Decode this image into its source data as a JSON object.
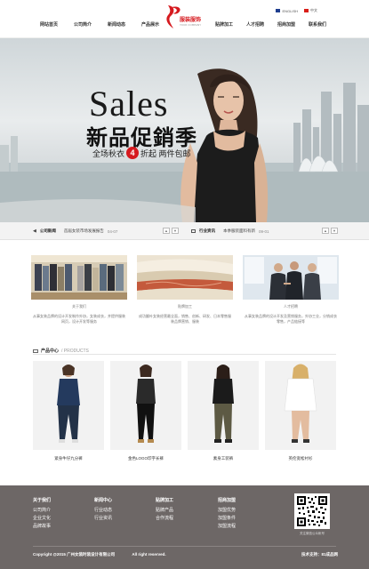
{
  "header": {
    "lang_en": "ENGLISH",
    "lang_cn": "中文",
    "logo_text": "服装服饰",
    "logo_sub": "YOUR COMPANY",
    "nav_left": [
      "网站首页",
      "公司简介",
      "新闻动态",
      "产品展示"
    ],
    "nav_right": [
      "贴牌加工",
      "人才招聘",
      "招商加盟",
      "联系我们"
    ]
  },
  "banner": {
    "title_en": "Sales",
    "title_cn": "新品促銷季",
    "sub_before": "全场秋衣",
    "sub_num": "4",
    "sub_after": "折起 两件包邮"
  },
  "newsbar": {
    "left_label": "公司新闻",
    "left_text": "首届女装市场发展报告",
    "left_date": "04-07",
    "right_label": "行业资讯",
    "right_text": "本季服装面料有新",
    "right_date": "09-01"
  },
  "features": [
    {
      "title": "关于我们",
      "desc": "从事女装品牌的设计开发制作外协，女装成衣，并提供服装网页，设计开发等服务"
    },
    {
      "title": "贴牌加工",
      "desc": "成功翻叶女装经营最全面，销售、创新、研发、日本零售服装品牌营销、服装"
    },
    {
      "title": "人才招聘",
      "desc": "从事女装品牌的设计开发及营销服务，外协工业，分销成衣零售，产品链接等"
    }
  ],
  "products": {
    "title_cn": "产品中心",
    "title_en": "/ PRODUCTS",
    "items": [
      {
        "name": "紧身牛仔九分裤"
      },
      {
        "name": "金色LOGO印字长裤"
      },
      {
        "name": "素身工装裤"
      },
      {
        "name": "英伦宽松衬衫"
      }
    ]
  },
  "footer": {
    "cols": [
      {
        "head": "关于我们",
        "items": [
          "公司简介",
          "企业文化",
          "品牌故事"
        ]
      },
      {
        "head": "新闻中心",
        "items": [
          "行业动态",
          "行业资讯"
        ]
      },
      {
        "head": "贴牌加工",
        "items": [
          "贴牌产品",
          "合作流程"
        ]
      },
      {
        "head": "招商加盟",
        "items": [
          "加盟优势",
          "加盟条件",
          "加盟流程"
        ]
      }
    ],
    "qr_caption": "关注微信公众帐号",
    "copyright": "Copyright @2015 广州女装时装设计有限公司",
    "rights": "All right reserved.",
    "tech": "技术支持：81成品网"
  },
  "colors": {
    "accent": "#d61a1f",
    "footer_bg": "#6d6766"
  }
}
